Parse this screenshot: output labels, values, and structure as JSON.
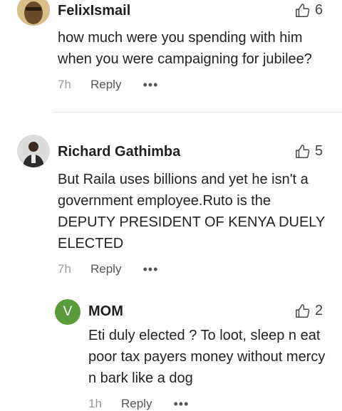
{
  "comments": [
    {
      "username": "FelixIsmail",
      "likes": "6",
      "text": "how much were you spending with him when you were campaigning for jubilee?",
      "time": "7h",
      "reply_label": "Reply",
      "more": "•••"
    },
    {
      "username": "Richard Gathimba",
      "likes": "5",
      "text": "But Raila uses billions and yet he isn't a government employee.Ruto is the DEPUTY PRESIDENT OF KENYA DUELY ELECTED",
      "time": "7h",
      "reply_label": "Reply",
      "more": "•••"
    },
    {
      "username": "MOM",
      "avatar_letter": "V",
      "avatar_color": "#5a9a3a",
      "likes": "2",
      "text": "Eti duly elected ? To loot, sleep n eat poor tax payers money without mercy n bark like a dog",
      "time": "1h",
      "reply_label": "Reply",
      "more": "•••"
    }
  ]
}
